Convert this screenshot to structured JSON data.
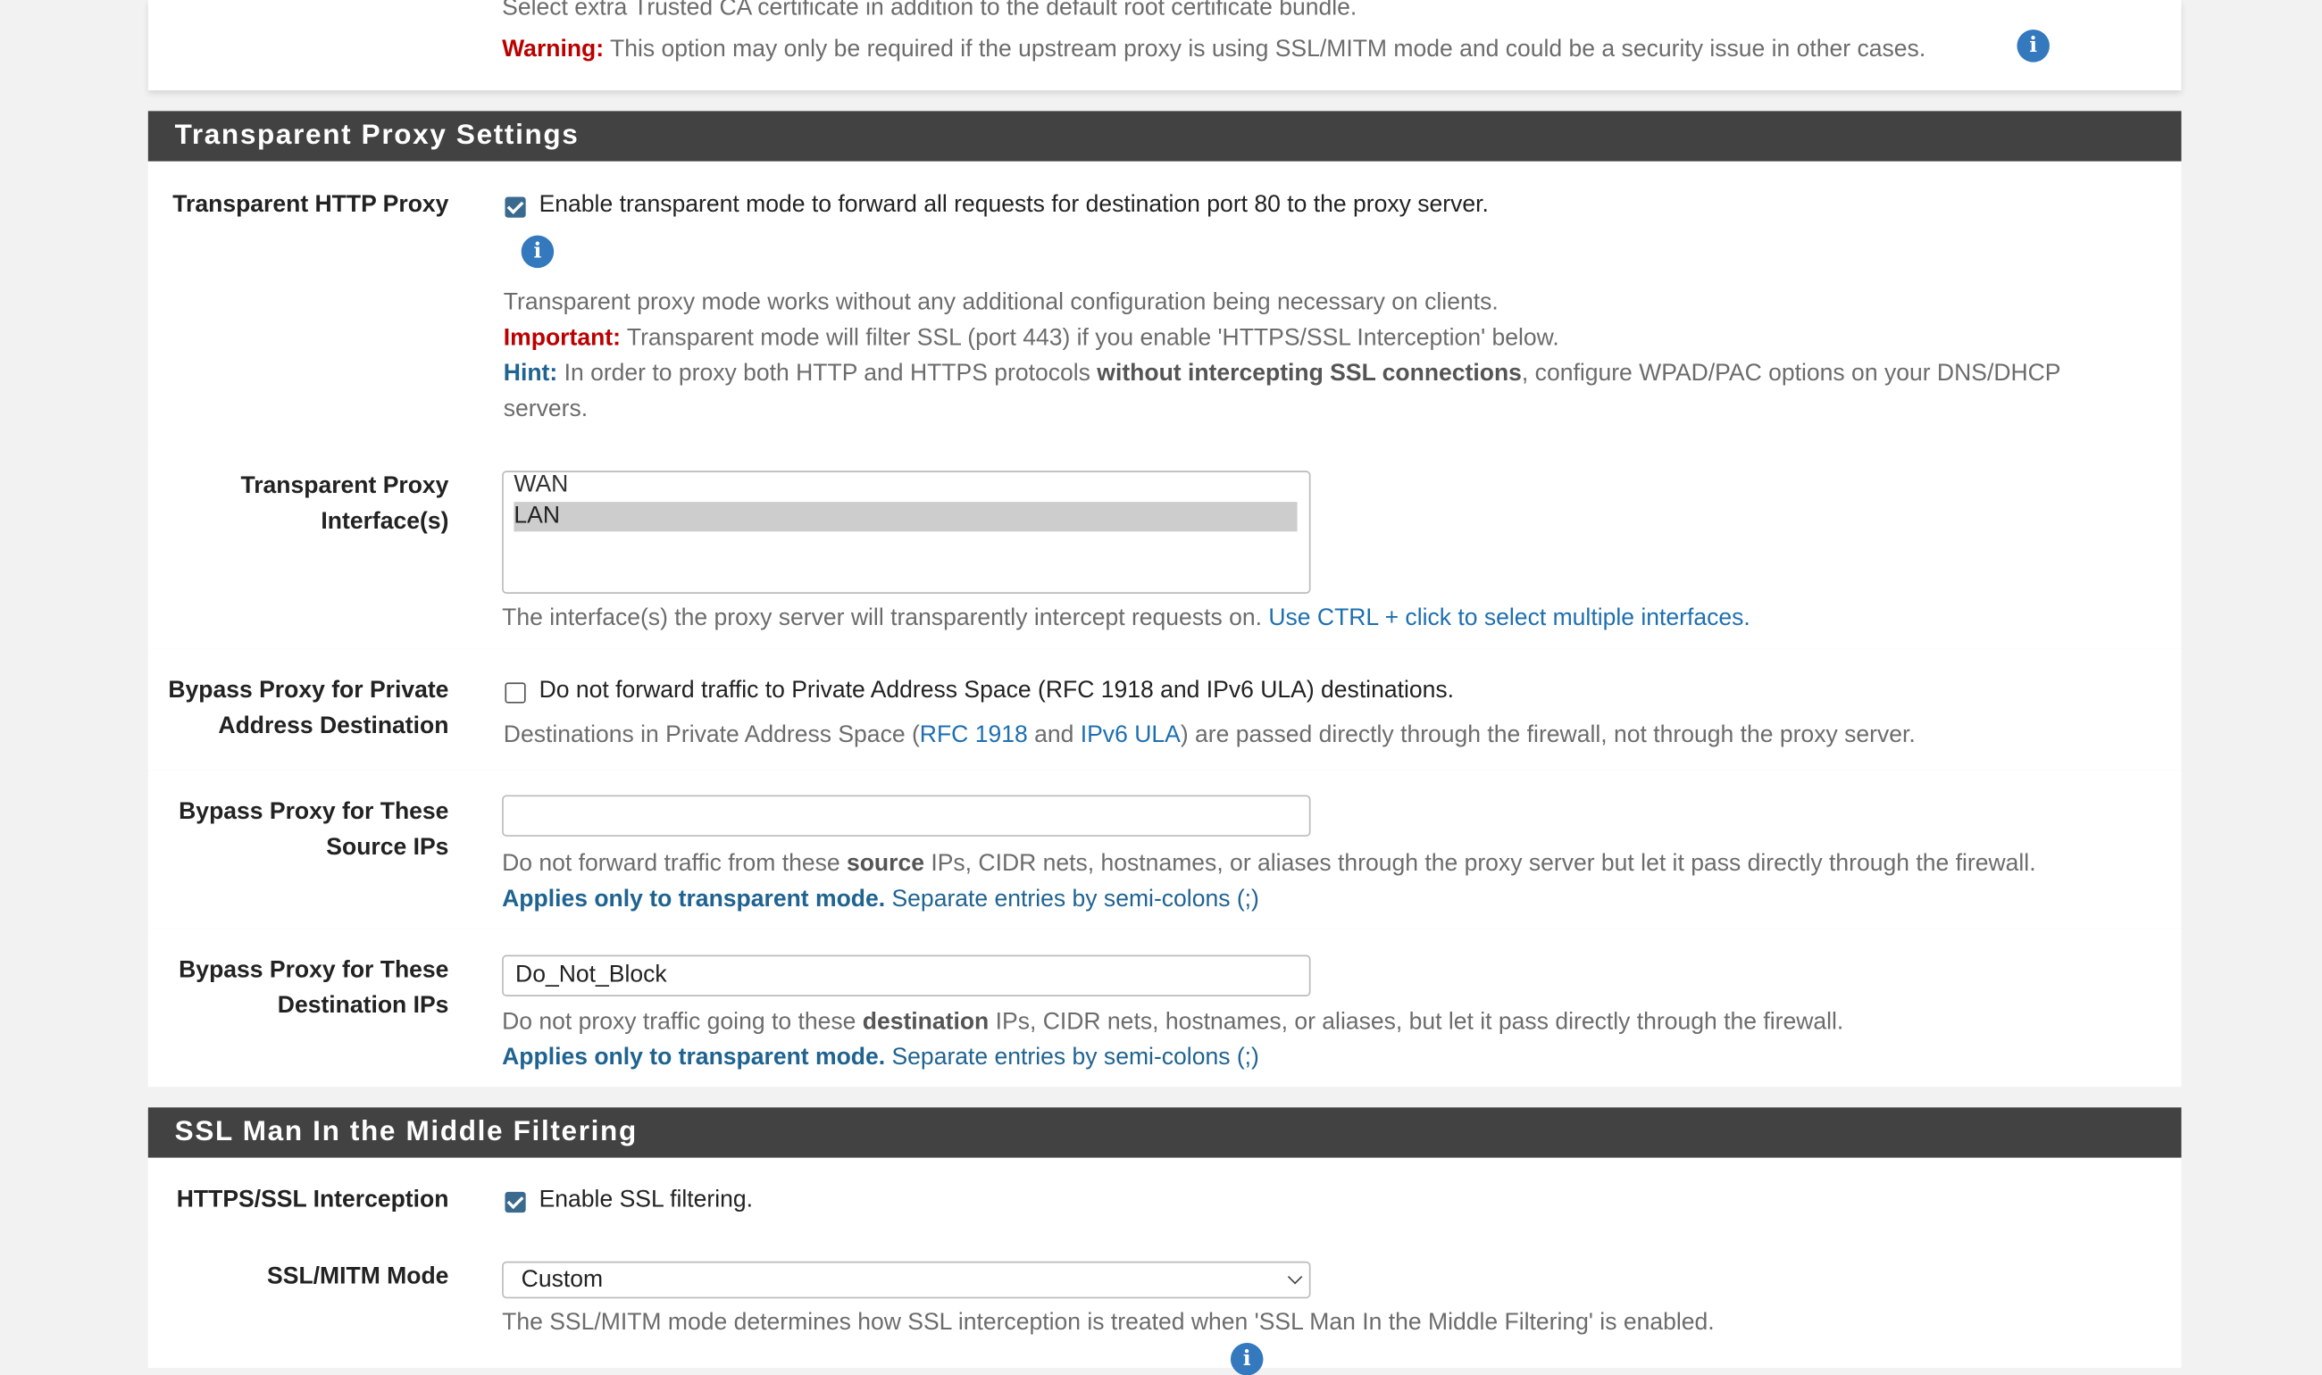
{
  "top_section": {
    "ca_help": "Select extra Trusted CA certificate in addition to the default root certificate bundle.",
    "warning_label": "Warning:",
    "warning_text": " This option may only be required if the upstream proxy is using SSL/MITM mode and could be a security issue in other cases."
  },
  "transparent": {
    "title": "Transparent Proxy Settings",
    "http_proxy": {
      "label": "Transparent HTTP Proxy",
      "checked": true,
      "checkbox_text": "Enable transparent mode to forward all requests for destination port 80 to the proxy server.",
      "help1": "Transparent proxy mode works without any additional configuration being necessary on clients.",
      "important_label": "Important:",
      "important_text": " Transparent mode will filter SSL (port 443) if you enable 'HTTPS/SSL Interception' below.",
      "hint_label": "Hint:",
      "hint_text1": " In order to proxy both HTTP and HTTPS protocols ",
      "hint_bold": "without intercepting SSL connections",
      "hint_text2": ", configure WPAD/PAC options on your DNS/DHCP",
      "hint_text3": "servers."
    },
    "interfaces": {
      "label_line1": "Transparent Proxy",
      "label_line2": "Interface(s)",
      "options": [
        "WAN",
        "LAN"
      ],
      "selected": "LAN",
      "help": "The interface(s) the proxy server will transparently intercept requests on. ",
      "help_link": "Use CTRL + click to select multiple interfaces."
    },
    "bypass_private": {
      "label_line1": "Bypass Proxy for Private",
      "label_line2": "Address Destination",
      "checked": false,
      "checkbox_text": "Do not forward traffic to Private Address Space (RFC 1918 and IPv6 ULA) destinations.",
      "help_a": "Destinations in Private Address Space (",
      "link1": "RFC 1918",
      "help_b": " and ",
      "link2": "IPv6 ULA",
      "help_c": ") are passed directly through the firewall, not through the proxy server."
    },
    "bypass_source": {
      "label_line1": "Bypass Proxy for These",
      "label_line2": "Source IPs",
      "value": "",
      "help_a": "Do not forward traffic from these ",
      "help_bold": "source",
      "help_b": " IPs, CIDR nets, hostnames, or aliases through the proxy server but let it pass directly through the firewall.",
      "applies": "Applies only to transparent mode.",
      "separate": " Separate entries by semi-colons (;)"
    },
    "bypass_dest": {
      "label_line1": "Bypass Proxy for These",
      "label_line2": "Destination IPs",
      "value": "Do_Not_Block",
      "help_a": "Do not proxy traffic going to these ",
      "help_bold": "destination",
      "help_b": " IPs, CIDR nets, hostnames, or aliases, but let it pass directly through the firewall.",
      "applies": "Applies only to transparent mode.",
      "separate": " Separate entries by semi-colons (;)"
    }
  },
  "ssl": {
    "title": "SSL Man In the Middle Filtering",
    "interception": {
      "label": "HTTPS/SSL Interception",
      "checked": true,
      "checkbox_text": "Enable SSL filtering."
    },
    "mode": {
      "label": "SSL/MITM Mode",
      "selected": "Custom",
      "help": "The SSL/MITM mode determines how SSL interception is treated when 'SSL Man In the Middle Filtering' is enabled."
    }
  },
  "icons": {
    "info": "info-circle-icon",
    "check": "checkbox-checked",
    "chevron": "chevron-down-icon"
  },
  "colors": {
    "header_bg": "#424242",
    "warning": "#bb0000",
    "hint": "#1f6391",
    "link": "#1e6fb0",
    "info": "#3478be"
  }
}
